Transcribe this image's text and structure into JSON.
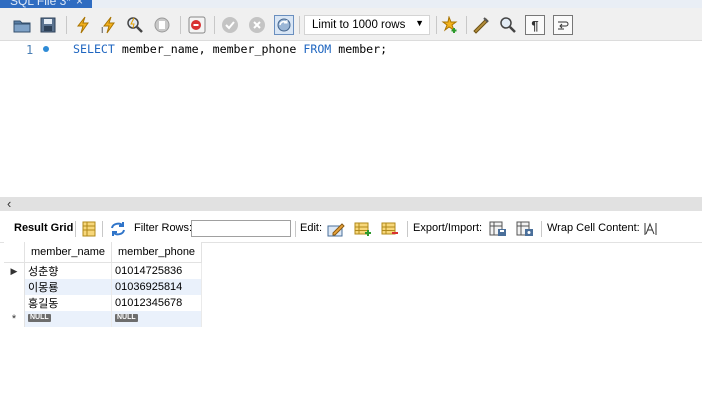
{
  "tab": {
    "title": "SQL File 3*",
    "close": "×"
  },
  "toolbar": {
    "limit_label": "Limit to 1000 rows",
    "icons": [
      "open-folder-icon",
      "save-icon",
      "execute-icon",
      "execute-current-icon",
      "explain-icon",
      "stop-icon",
      "toggle-error-icon",
      "commit-icon",
      "rollback-icon",
      "autocommit-icon",
      "bookmark-star-icon",
      "beautify-icon",
      "find-icon",
      "invisible-chars-icon",
      "wrap-icon"
    ]
  },
  "editor": {
    "line_number": "1",
    "tokens": [
      {
        "text": "SELECT",
        "kind": "kw"
      },
      {
        "text": " member_name, member_phone ",
        "kind": "plain"
      },
      {
        "text": "FROM",
        "kind": "kw"
      },
      {
        "text": " member",
        "kind": "plain"
      },
      {
        "text": ";",
        "kind": "plain"
      }
    ]
  },
  "result_toolbar": {
    "result_grid": "Result Grid",
    "filter_rows": "Filter Rows:",
    "edit": "Edit:",
    "export_import": "Export/Import:",
    "wrap_cell": "Wrap Cell Content:"
  },
  "grid": {
    "columns": [
      "member_name",
      "member_phone"
    ],
    "rows": [
      [
        "성춘향",
        "01014725836"
      ],
      [
        "이몽룡",
        "01036925814"
      ],
      [
        "홍길동",
        "01012345678"
      ]
    ],
    "new_row_marker": "*",
    "null_label": "NULL"
  }
}
